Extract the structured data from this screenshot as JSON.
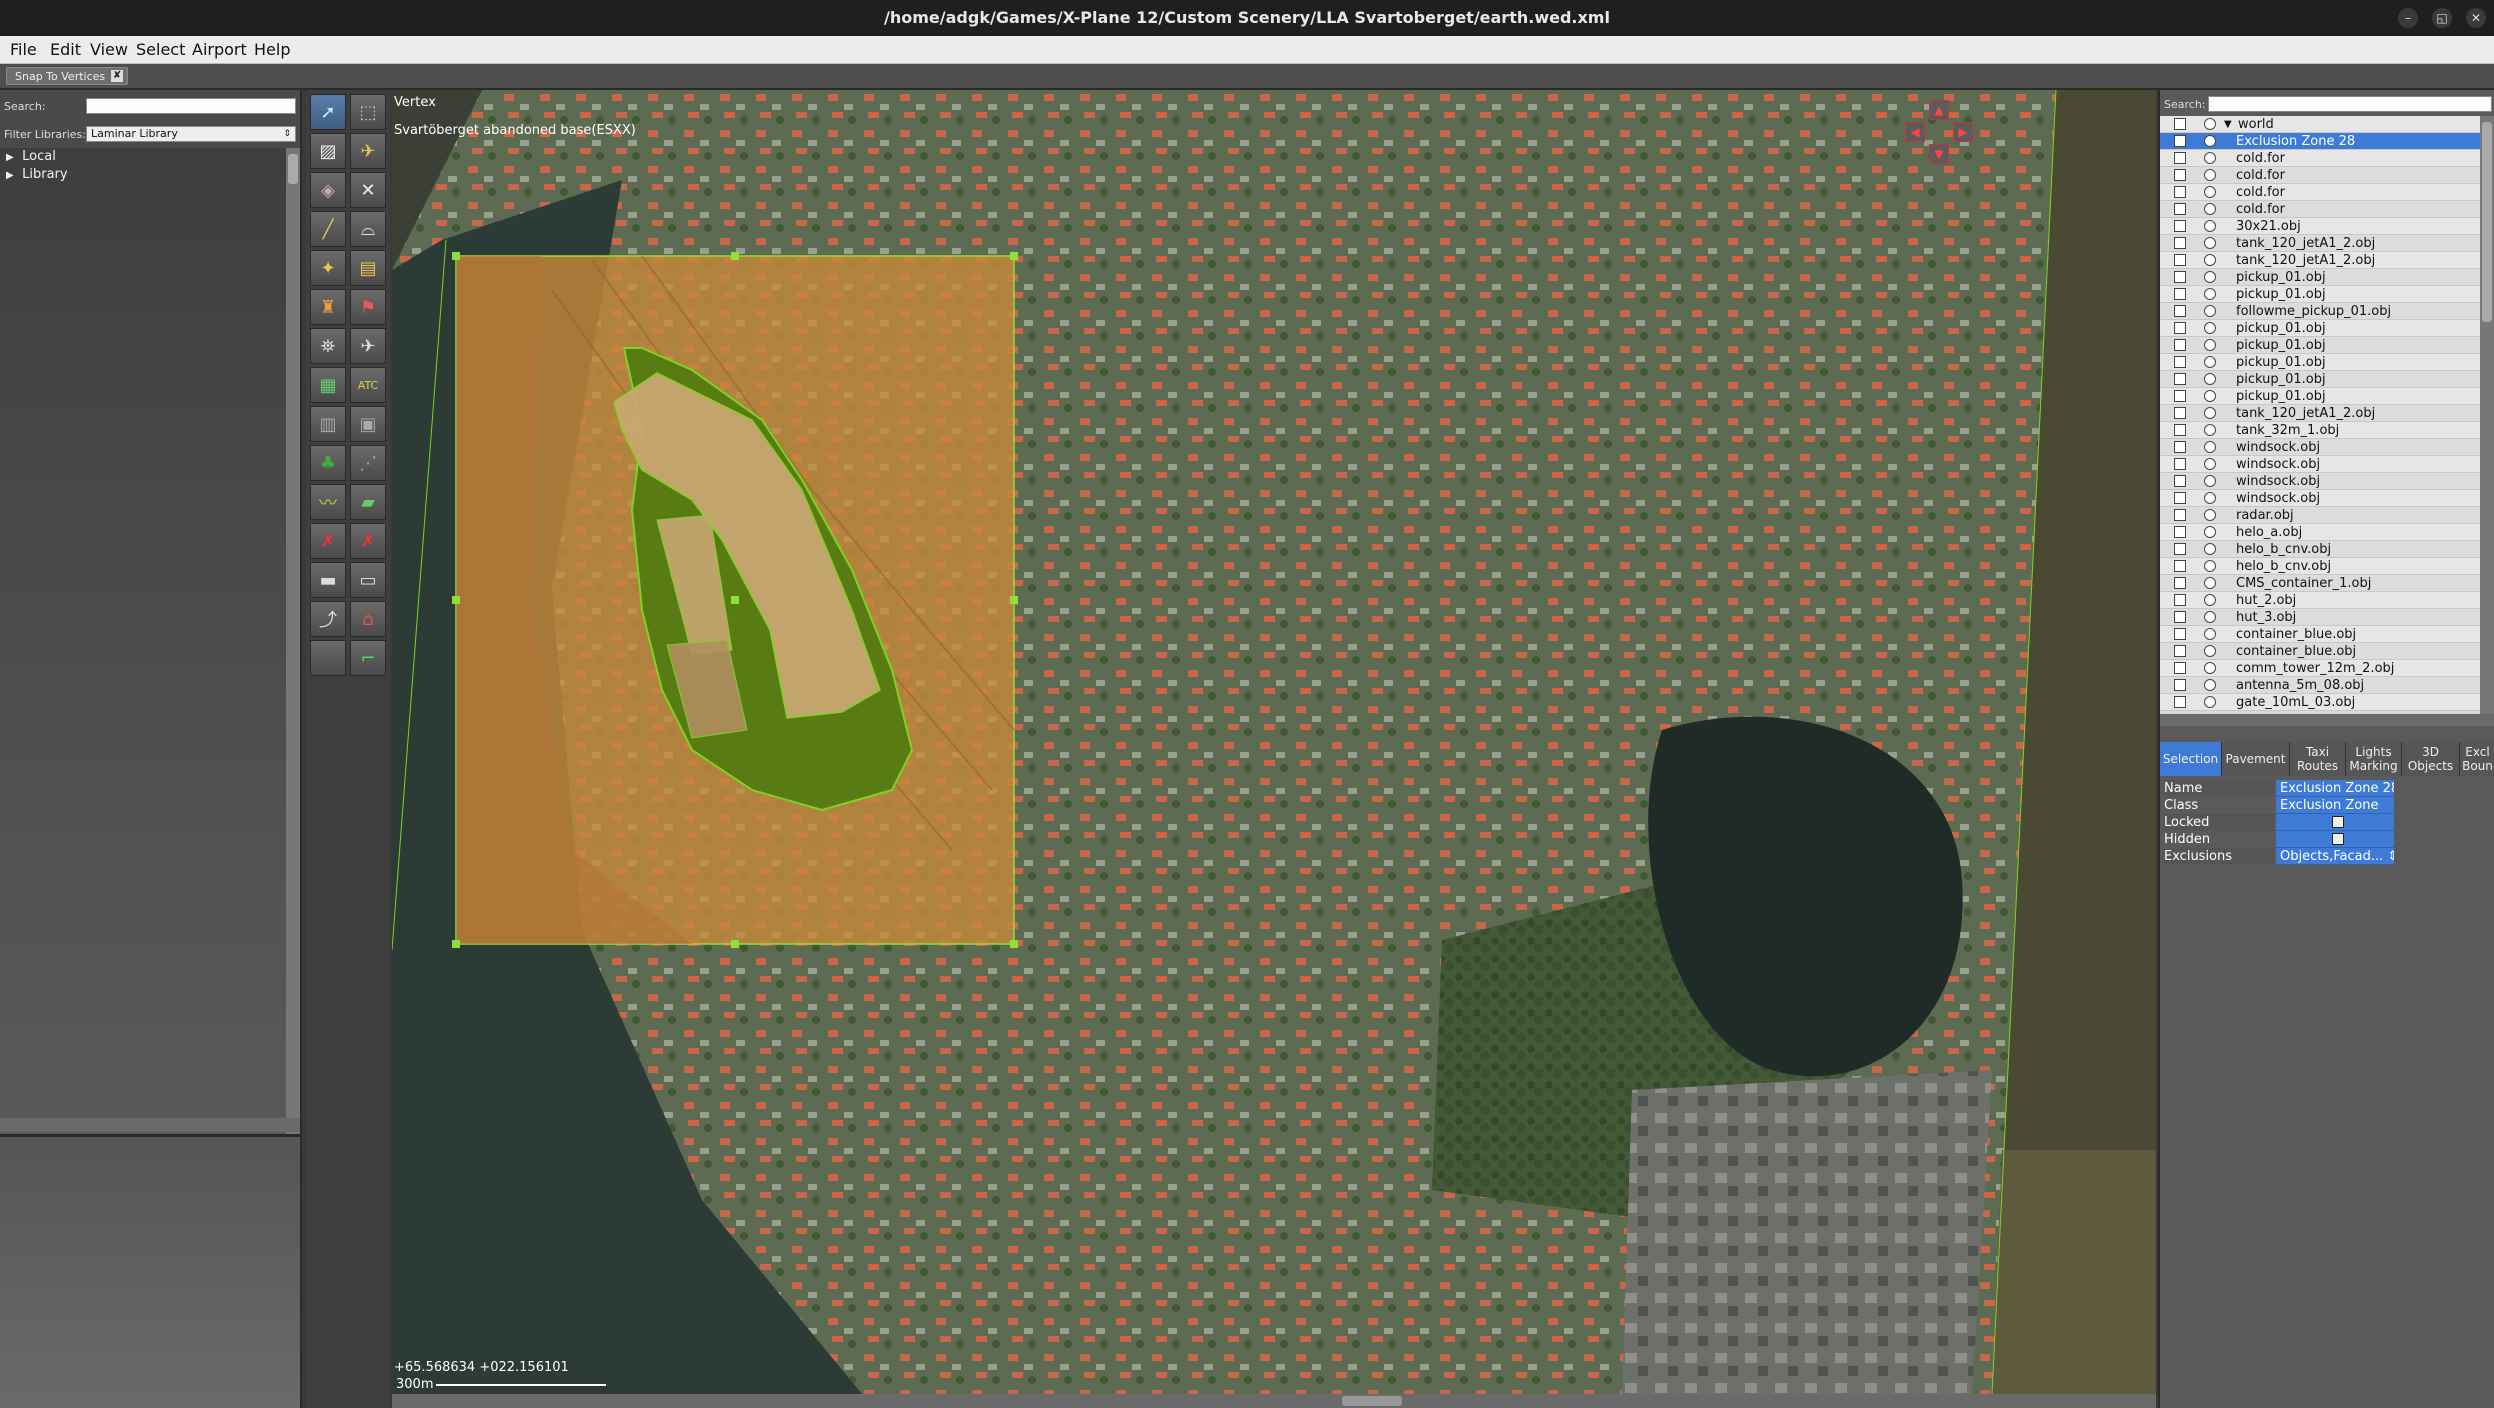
{
  "window": {
    "title": "/home/adgk/Games/X-Plane 12/Custom Scenery/LLA Svartoberget/earth.wed.xml",
    "minimize_glyph": "–",
    "restore_glyph": "◱",
    "close_glyph": "✕"
  },
  "menu": [
    "File",
    "Edit",
    "View",
    "Select",
    "Airport",
    "Help"
  ],
  "snap": {
    "label": "Snap To Vertices",
    "check": "✘"
  },
  "library": {
    "search_label": "Search:",
    "search_value": "",
    "filter_label": "Filter Libraries:",
    "filter_value": "Laminar Library",
    "filter_arrow": "⇕",
    "items": [
      {
        "label": "Local",
        "tri": "▶"
      },
      {
        "label": "Library",
        "tri": "▶"
      }
    ]
  },
  "map": {
    "tool_name": "Vertex",
    "airport_name": "Svartöberget abandoned base(ESXX)",
    "coords": "+65.568634 +022.156101",
    "scale": "300m"
  },
  "hierarchy": {
    "search_label": "Search:",
    "search_value": "",
    "rows": [
      {
        "label": "world",
        "tri": "▼",
        "selected": false
      },
      {
        "label": "Exclusion Zone 28",
        "selected": true
      },
      {
        "label": "cold.for"
      },
      {
        "label": "cold.for"
      },
      {
        "label": "cold.for"
      },
      {
        "label": "cold.for"
      },
      {
        "label": "30x21.obj"
      },
      {
        "label": "tank_120_jetA1_2.obj"
      },
      {
        "label": "tank_120_jetA1_2.obj"
      },
      {
        "label": "pickup_01.obj"
      },
      {
        "label": "pickup_01.obj"
      },
      {
        "label": "followme_pickup_01.obj"
      },
      {
        "label": "pickup_01.obj"
      },
      {
        "label": "pickup_01.obj"
      },
      {
        "label": "pickup_01.obj"
      },
      {
        "label": "pickup_01.obj"
      },
      {
        "label": "pickup_01.obj"
      },
      {
        "label": "tank_120_jetA1_2.obj"
      },
      {
        "label": "tank_32m_1.obj"
      },
      {
        "label": "windsock.obj"
      },
      {
        "label": "windsock.obj"
      },
      {
        "label": "windsock.obj"
      },
      {
        "label": "windsock.obj"
      },
      {
        "label": "radar.obj"
      },
      {
        "label": "helo_a.obj"
      },
      {
        "label": "helo_b_cnv.obj"
      },
      {
        "label": "helo_b_cnv.obj"
      },
      {
        "label": "CMS_container_1.obj"
      },
      {
        "label": "hut_2.obj"
      },
      {
        "label": "hut_3.obj"
      },
      {
        "label": "container_blue.obj"
      },
      {
        "label": "container_blue.obj"
      },
      {
        "label": "comm_tower_12m_2.obj"
      },
      {
        "label": "antenna_5m_08.obj"
      },
      {
        "label": "gate_10mL_03.obj"
      }
    ]
  },
  "tabs": [
    {
      "label": "Selection",
      "active": true
    },
    {
      "label": "Pavement",
      "active": false
    },
    {
      "label": "Taxi Routes",
      "active": false
    },
    {
      "label": "Lights Marking",
      "active": false
    },
    {
      "label": "3D Objects",
      "active": false
    },
    {
      "label": "Excl Boun",
      "active": false
    }
  ],
  "properties": [
    {
      "key": "Name",
      "value": "Exclusion Zone 28",
      "type": "text"
    },
    {
      "key": "Class",
      "value": "Exclusion Zone",
      "type": "text"
    },
    {
      "key": "Locked",
      "value": "",
      "type": "check"
    },
    {
      "key": "Hidden",
      "value": "",
      "type": "check"
    },
    {
      "key": "Exclusions",
      "value": "Objects,Facad... ⇕",
      "type": "text"
    }
  ],
  "colors": {
    "selection_blue": "#3d7bd6",
    "exclusion_fill": "#c98a3a",
    "boundary_green": "#7ed321",
    "airport_fill": "#4f7a10"
  }
}
